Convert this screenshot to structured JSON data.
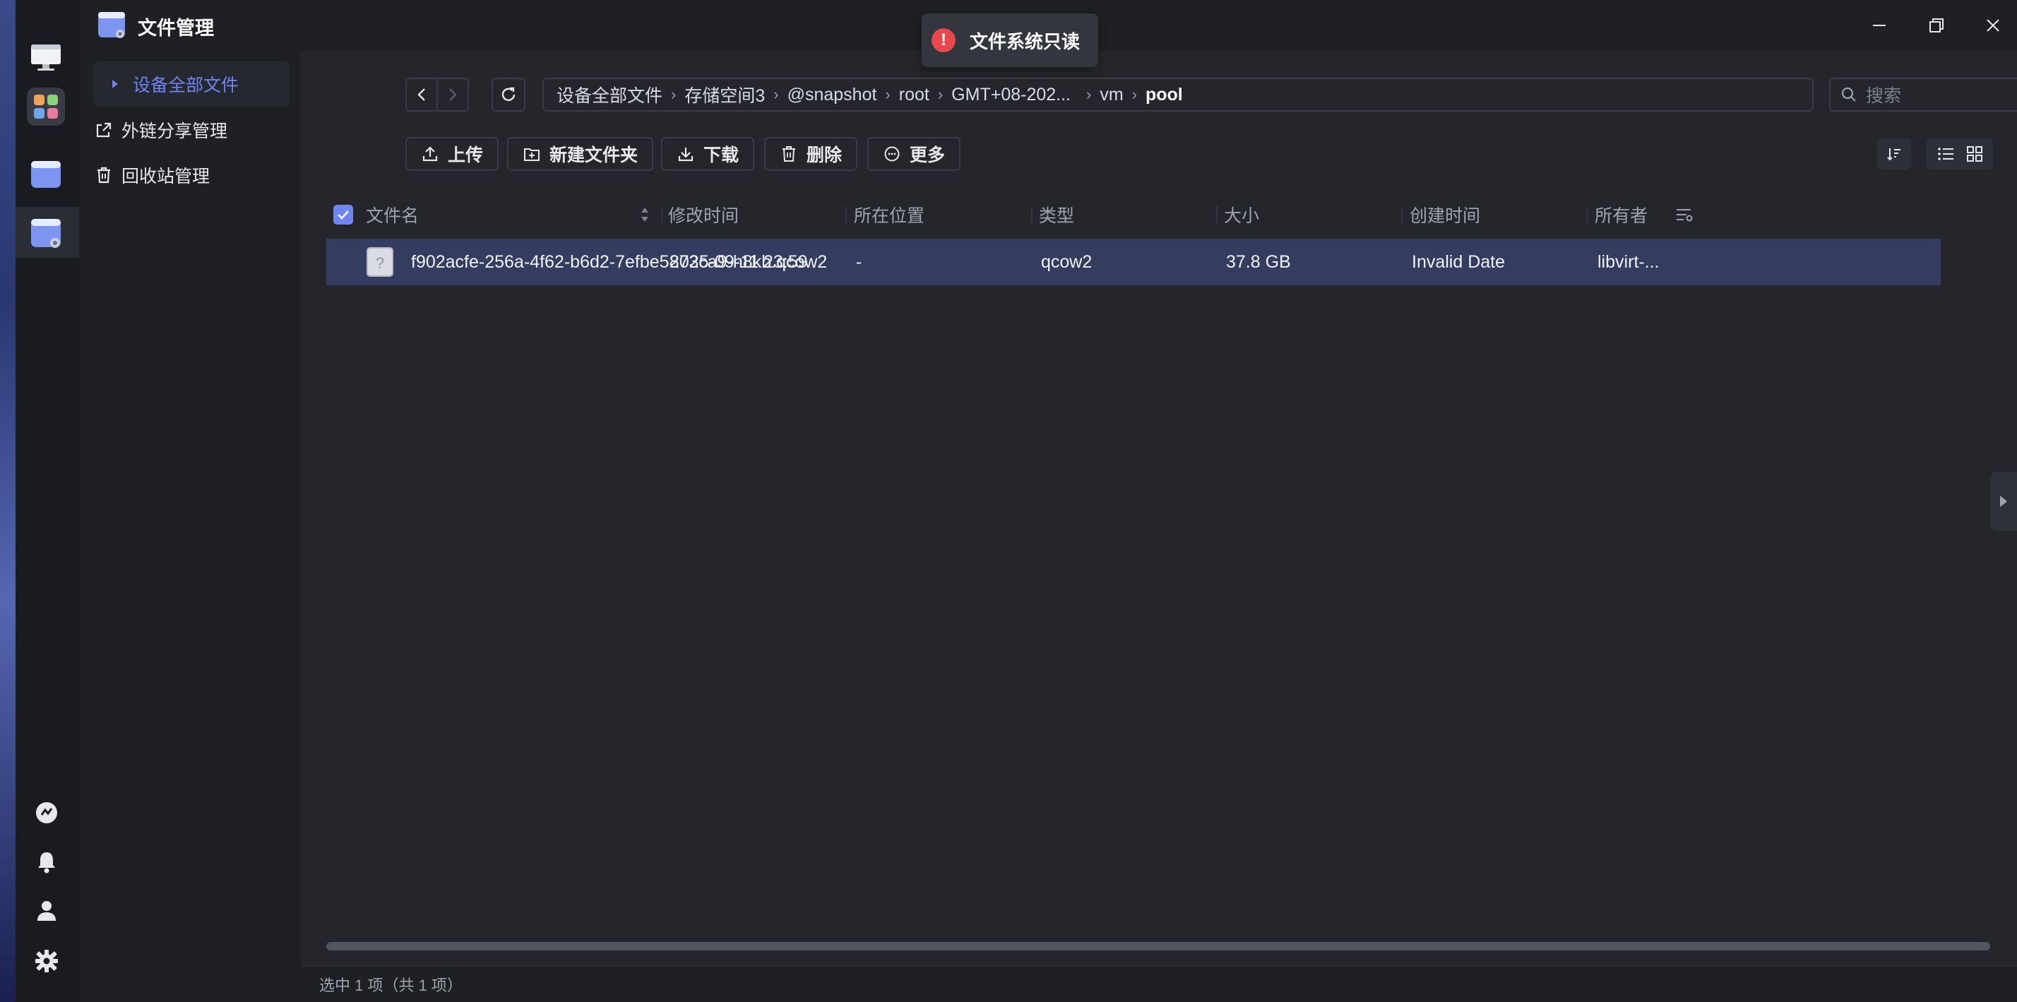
{
  "app": {
    "title": "文件管理"
  },
  "toast": {
    "message": "文件系统只读",
    "icon": "error-icon",
    "color": "#e5484d"
  },
  "sidebar": {
    "items": [
      {
        "label": "设备全部文件",
        "icon": "caret-right-icon",
        "active": true
      },
      {
        "label": "外链分享管理",
        "icon": "share-link-icon"
      },
      {
        "label": "回收站管理",
        "icon": "trash-icon"
      }
    ]
  },
  "breadcrumb": [
    "设备全部文件",
    "存储空间3",
    "@snapshot",
    "root",
    "GMT+08-202...",
    "vm",
    "pool"
  ],
  "search": {
    "placeholder": "搜索"
  },
  "actions": [
    {
      "label": "上传",
      "icon": "upload-icon"
    },
    {
      "label": "新建文件夹",
      "icon": "new-folder-icon"
    },
    {
      "label": "下载",
      "icon": "download-icon"
    },
    {
      "label": "删除",
      "icon": "delete-icon"
    },
    {
      "label": "更多",
      "icon": "more-icon"
    }
  ],
  "table": {
    "columns": [
      "文件名",
      "修改时间",
      "所在位置",
      "类型",
      "大小",
      "创建时间",
      "所有者"
    ],
    "rows": [
      {
        "name": "f902acfe-256a-4f62-b6d2-7efbe5873ca9-h8kb.qcow2",
        "modified": "2025-09-11 23:59",
        "location": "-",
        "type": "qcow2",
        "size": "37.8 GB",
        "created": "Invalid Date",
        "owner": "libvirt-..."
      }
    ]
  },
  "status": {
    "text": "选中 1 项（共 1 项）"
  },
  "colors": {
    "accent": "#6f85f2",
    "selected_row": "#343c60"
  }
}
